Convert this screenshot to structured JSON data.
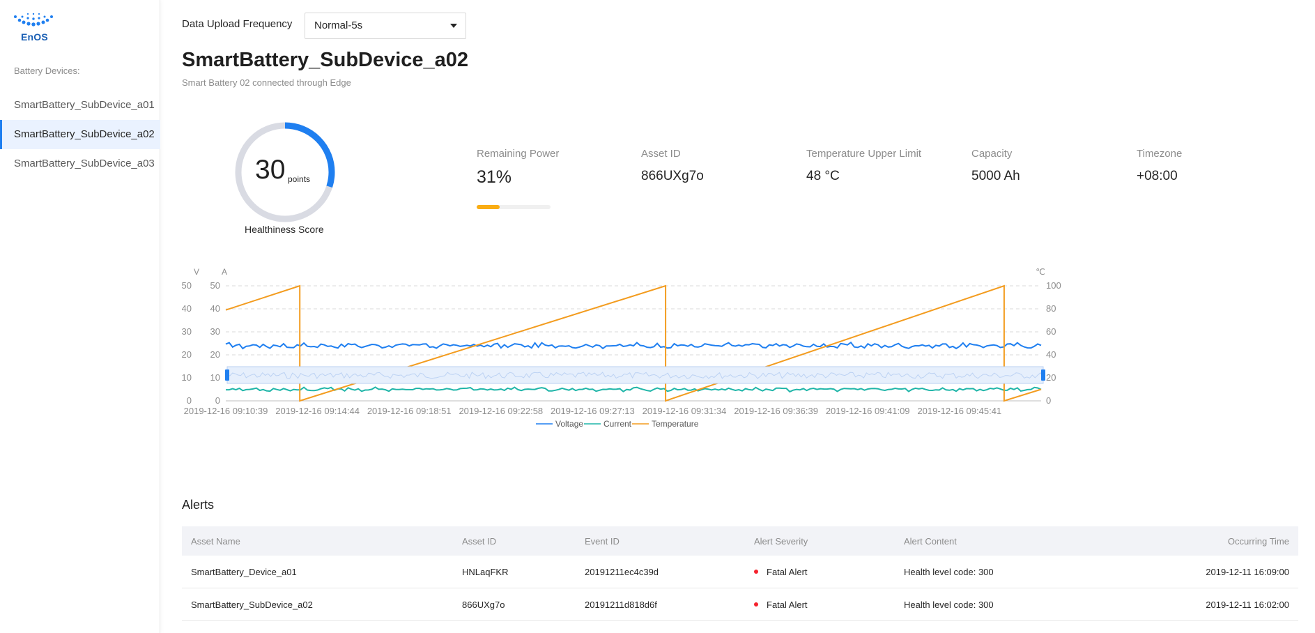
{
  "sidebar": {
    "logo_text": "EnOS",
    "heading": "Battery Devices:",
    "items": [
      {
        "label": "SmartBattery_SubDevice_a01"
      },
      {
        "label": "SmartBattery_SubDevice_a02"
      },
      {
        "label": "SmartBattery_SubDevice_a03"
      }
    ],
    "active_index": 1
  },
  "controls": {
    "upload_label": "Data Upload Frequency",
    "upload_value": "Normal-5s"
  },
  "device": {
    "title": "SmartBattery_SubDevice_a02",
    "subtitle": "Smart Battery 02 connected through Edge"
  },
  "health": {
    "score": "30",
    "unit": "points",
    "caption": "Healthiness Score",
    "fraction": 0.3
  },
  "stats": {
    "remaining_power": {
      "label": "Remaining Power",
      "value": "31%",
      "fraction": 0.31
    },
    "asset_id": {
      "label": "Asset ID",
      "value": "866UXg7o"
    },
    "temperature_limit": {
      "label": "Temperature Upper Limit",
      "value": "48 °C"
    },
    "capacity": {
      "label": "Capacity",
      "value": "5000 Ah"
    },
    "timezone": {
      "label": "Timezone",
      "value": "+08:00"
    }
  },
  "colors": {
    "accent": "#1f7ff0",
    "voltage": "#1f7ff0",
    "current": "#1fb5a8",
    "temperature": "#f39c1f",
    "progress": "#faad14",
    "alert": "#f5222d"
  },
  "chart_data": {
    "type": "line",
    "axes": {
      "voltage": {
        "label": "V",
        "ticks": [
          "50",
          "40",
          "30",
          "20",
          "10",
          "0"
        ],
        "range": [
          0,
          50
        ]
      },
      "current": {
        "label": "A",
        "ticks": [
          "50",
          "40",
          "30",
          "20",
          "10",
          "0"
        ],
        "range": [
          0,
          50
        ]
      },
      "temperature": {
        "label": "℃",
        "ticks": [
          "100",
          "80",
          "60",
          "40",
          "20",
          "0"
        ],
        "range": [
          0,
          100
        ]
      }
    },
    "x_tick_labels": [
      "2019-12-16 09:10:39",
      "2019-12-16 09:14:44",
      "2019-12-16 09:18:51",
      "2019-12-16 09:22:58",
      "2019-12-16 09:27:13",
      "2019-12-16 09:31:34",
      "2019-12-16 09:36:39",
      "2019-12-16 09:41:09",
      "2019-12-16 09:45:41"
    ],
    "series": [
      {
        "name": "Voltage",
        "axis": "voltage",
        "approx_value": 24,
        "noise": 1.2
      },
      {
        "name": "Current",
        "axis": "current",
        "approx_value": 5,
        "noise": 0.8
      },
      {
        "name": "Temperature",
        "axis": "temperature",
        "shape": "sawtooth",
        "segments": [
          {
            "from_x": 0.0,
            "from_y": 79,
            "to_x": 0.0908,
            "to_y": 100
          },
          {
            "from_x": 0.0908,
            "from_y": 0,
            "to_x": 0.5394,
            "to_y": 100
          },
          {
            "from_x": 0.5394,
            "from_y": 0,
            "to_x": 0.9546,
            "to_y": 100
          },
          {
            "from_x": 0.9546,
            "from_y": 0,
            "to_x": 1.0,
            "to_y": 10
          }
        ]
      }
    ],
    "legend": "bottom-center",
    "grid": "dashed-horizontal",
    "has_zoom_slider": true
  },
  "alerts": {
    "title": "Alerts",
    "columns": [
      "Asset Name",
      "Asset ID",
      "Event ID",
      "Alert Severity",
      "Alert Content",
      "Occurring Time"
    ],
    "rows": [
      [
        "SmartBattery_Device_a01",
        "HNLaqFKR",
        "20191211ec4c39d",
        "Fatal Alert",
        "Health level code: 300",
        "2019-12-11 16:09:00"
      ],
      [
        "SmartBattery_SubDevice_a02",
        "866UXg7o",
        "20191211d818d6f",
        "Fatal Alert",
        "Health level code: 300",
        "2019-12-11 16:02:00"
      ]
    ]
  }
}
